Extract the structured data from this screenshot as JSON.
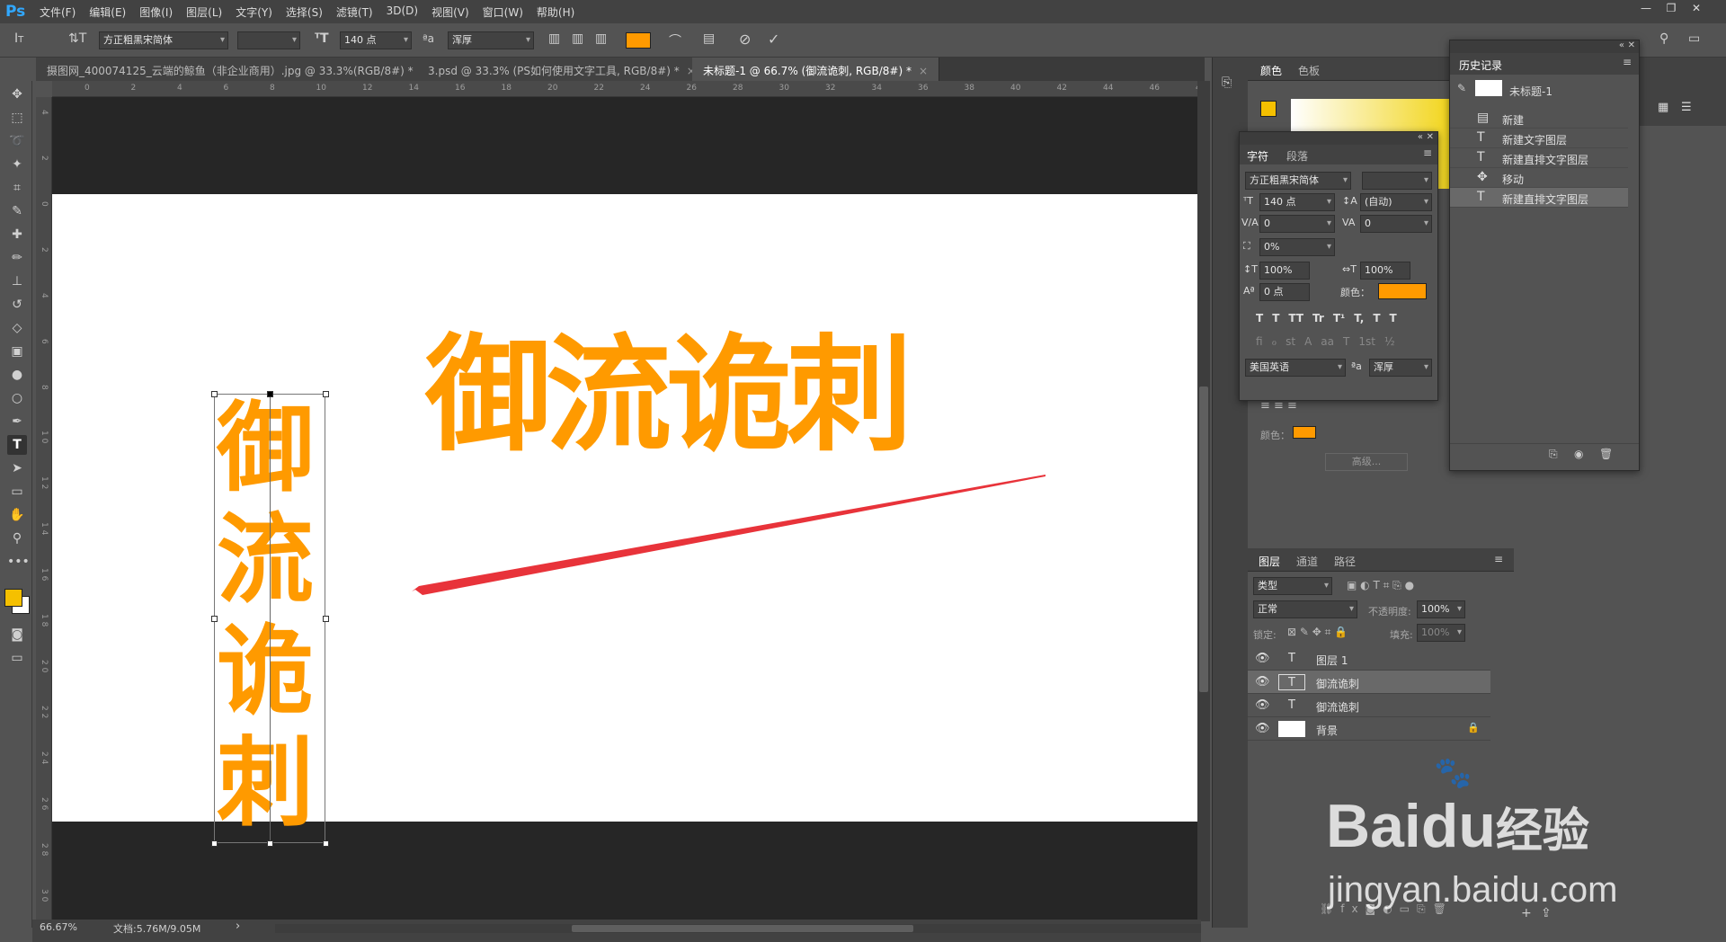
{
  "app": {
    "logo": "Ps"
  },
  "menu": [
    "文件(F)",
    "编辑(E)",
    "图像(I)",
    "图层(L)",
    "文字(Y)",
    "选择(S)",
    "滤镜(T)",
    "3D(D)",
    "视图(V)",
    "窗口(W)",
    "帮助(H)"
  ],
  "options": {
    "font_family": "方正粗黑宋简体",
    "font_size": "140 点",
    "aa_label": "ªa",
    "anti_alias": "浑厚",
    "color": "#ff9a00"
  },
  "tabs": [
    {
      "label": "摄图网_400074125_云端的鲸鱼（非企业商用）.jpg @ 33.3%(RGB/8#) *",
      "close": "×"
    },
    {
      "label": "3.psd @ 33.3% (PS如何使用文字工具, RGB/8#) *",
      "close": "×"
    },
    {
      "label": "未标题-1 @ 66.7% (御流诡刺, RGB/8#) *",
      "close": "×"
    }
  ],
  "ruler_h": [
    "0",
    "2",
    "4",
    "6",
    "8",
    "10",
    "12",
    "14",
    "16",
    "18",
    "20",
    "22",
    "24",
    "26",
    "28",
    "30",
    "32",
    "34",
    "36",
    "38",
    "40",
    "42",
    "44",
    "46",
    "48",
    "50"
  ],
  "ruler_v": [
    "4",
    "2",
    "0",
    "2",
    "4",
    "6",
    "8",
    "1 0",
    "1 2",
    "1 4",
    "1 6",
    "1 8",
    "2 0",
    "2 2",
    "2 4",
    "2 6",
    "2 8",
    "3 0"
  ],
  "canvas": {
    "horizontal_text": "御流诡刺",
    "vertical_text": [
      "御",
      "流",
      "诡",
      "刺"
    ],
    "text_color": "#ff9a00",
    "arrow_color": "#e8333a"
  },
  "status": {
    "zoom": "66.67%",
    "doc": "文档:5.76M/9.05M",
    "arrow": "›"
  },
  "color_panel": {
    "tabs": [
      "颜色",
      "色板"
    ],
    "fg": "#f5c000"
  },
  "character_panel": {
    "tabs": [
      "字符",
      "段落"
    ],
    "font_family": "方正粗黑宋简体",
    "font_size": "140 点",
    "leading": "(自动)",
    "kerning": "0",
    "tracking": "0",
    "scale_pct": "0%",
    "v_scale": "100%",
    "h_scale": "100%",
    "baseline": "0 点",
    "color_label": "颜色：",
    "language": "美国英语",
    "anti_alias": "浑厚",
    "style_buttons": [
      "T",
      "T",
      "TT",
      "Tr",
      "T¹",
      "T,",
      "T",
      "T"
    ],
    "ot_buttons": [
      "ﬁ",
      "ℴ",
      "st",
      "A",
      "aa",
      "T",
      "1st",
      "½"
    ]
  },
  "paragraph_stub": {
    "color_label": "颜色：",
    "advanced": "高级..."
  },
  "history_panel": {
    "title": "历史记录",
    "snapshot": "未标题-1",
    "items": [
      {
        "icon": "new-doc-icon",
        "label": "新建"
      },
      {
        "icon": "text-icon",
        "label": "新建文字图层"
      },
      {
        "icon": "text-icon",
        "label": "新建直排文字图层"
      },
      {
        "icon": "move-icon",
        "label": "移动"
      },
      {
        "icon": "text-icon",
        "label": "新建直排文字图层"
      }
    ]
  },
  "layers_panel": {
    "tabs": [
      "图层",
      "通道",
      "路径"
    ],
    "filter_kind": "类型",
    "blend": "正常",
    "opacity_label": "不透明度:",
    "opacity": "100%",
    "lock_label": "锁定:",
    "fill_label": "填充:",
    "fill": "100%",
    "layers": [
      {
        "name": "图层 1",
        "type": "text"
      },
      {
        "name": "御流诡刺",
        "type": "text",
        "selected": true
      },
      {
        "name": "御流诡刺",
        "type": "text"
      },
      {
        "name": "背景",
        "type": "background"
      }
    ]
  },
  "watermark": {
    "brand": "Bai",
    "brand2": "du",
    "cn": "经验",
    "url": "jingyan.baidu.com"
  }
}
